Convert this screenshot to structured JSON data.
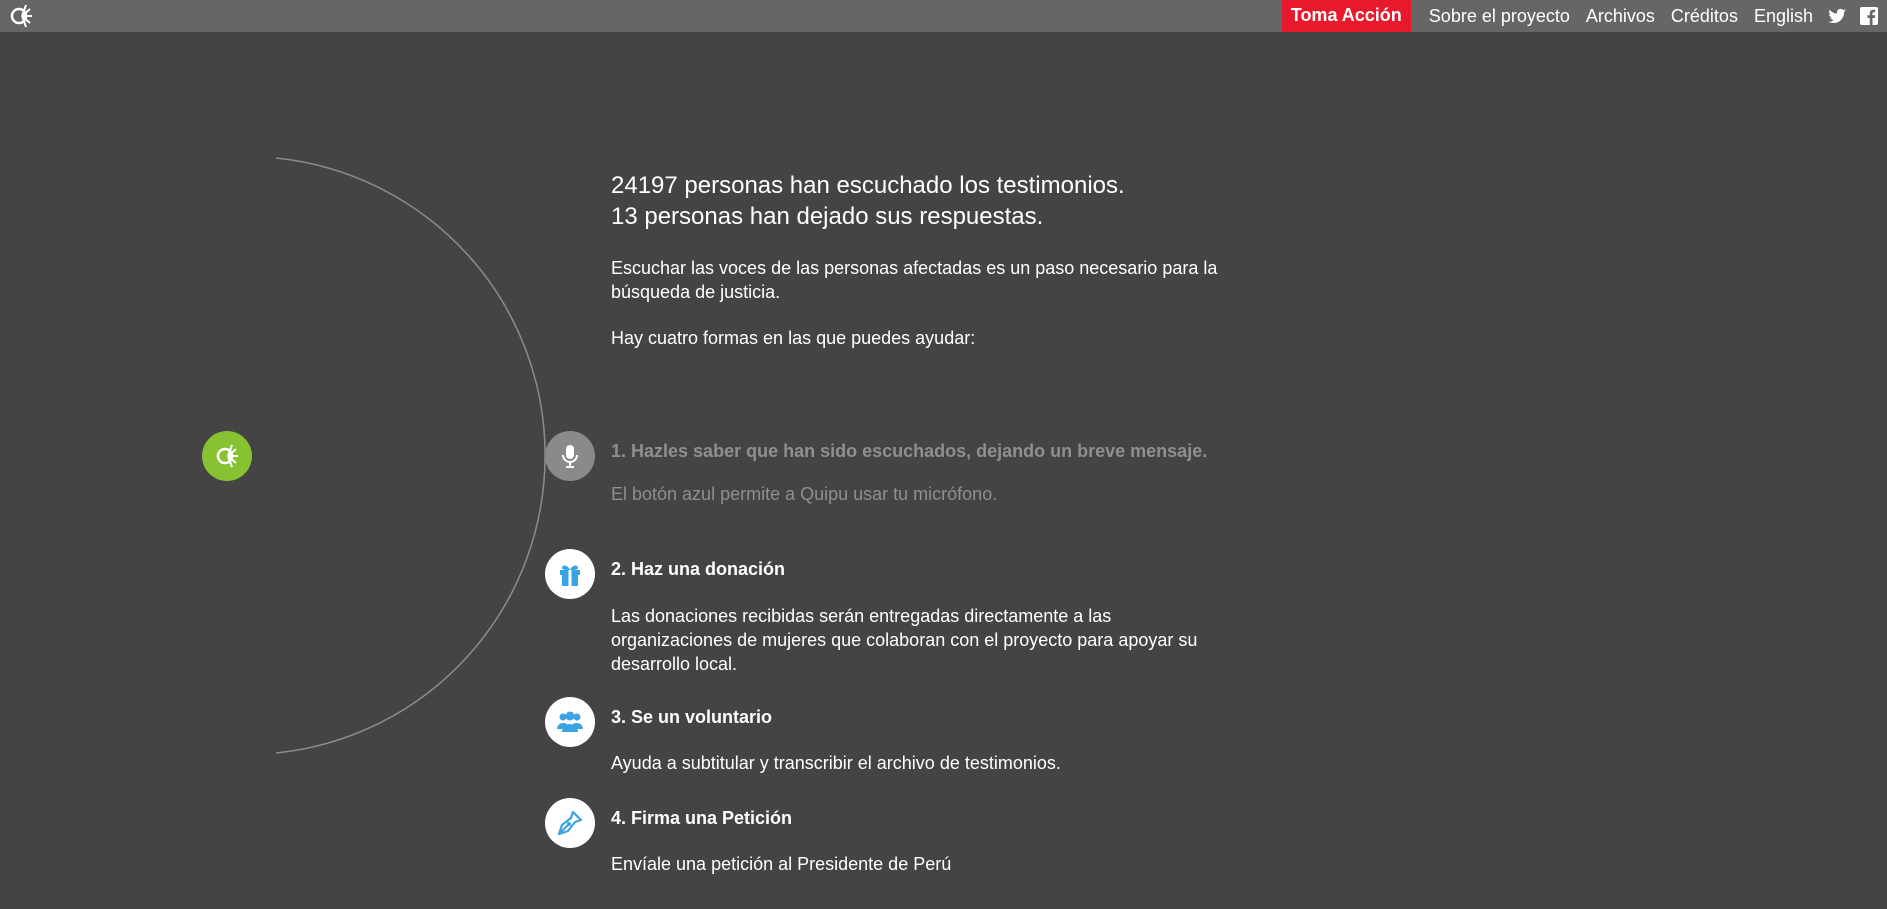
{
  "nav": {
    "cta": "Toma Acción",
    "links": [
      "Sobre el proyecto",
      "Archivos",
      "Créditos",
      "English"
    ],
    "social_icons": [
      "twitter-icon",
      "facebook-icon"
    ]
  },
  "colors": {
    "topbar": "#666666",
    "background": "#444444",
    "cta": "#e8192c",
    "hub": "#86c232",
    "icon_blue": "#3aa3e3"
  },
  "intro": {
    "line1": "24197 personas han escuchado los testimonios.",
    "line2": "13 personas han dejado sus respuestas.",
    "para1": "Escuchar las voces de las personas afectadas es un paso necesario para la búsqueda de justicia.",
    "para2": "Hay cuatro formas en las que puedes ayudar:"
  },
  "steps": [
    {
      "icon": "microphone-icon",
      "title": "1. Hazles saber que han sido escuchados, dejando un breve mensaje.",
      "desc": "El botón azul permite a Quipu usar tu micrófono."
    },
    {
      "icon": "gift-icon",
      "title": "2. Haz una donación",
      "desc": "Las donaciones recibidas serán entregadas directamente a las organizaciones de mujeres que colaboran con el proyecto para apoyar su desarrollo local."
    },
    {
      "icon": "group-icon",
      "title": "3. Se un voluntario",
      "desc": "Ayuda a subtitular y transcribir el archivo de testimonios."
    },
    {
      "icon": "pen-nib-icon",
      "title": "4. Firma una Petición",
      "desc": "Envíale una petición al Presidente de Perú"
    }
  ]
}
